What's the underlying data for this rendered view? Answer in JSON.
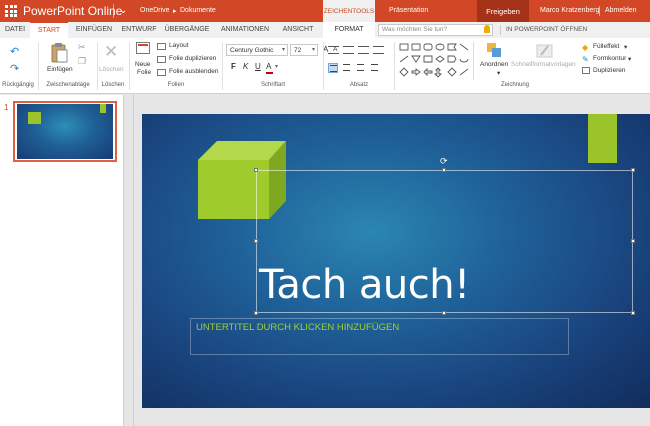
{
  "titlebar": {
    "app_title": "PowerPoint Online",
    "breadcrumb": [
      "OneDrive",
      "Dokumente"
    ],
    "breadcrumb_arrow": "▸",
    "contextual_header": "ZEICHENTOOLS",
    "document_title": "Präsentation",
    "share_label": "Freigeben",
    "user_name": "Marco Kratzenberg",
    "logout_label": "Abmelden",
    "accent_color": "#d24726"
  },
  "tabs": [
    "DATEI",
    "START",
    "EINFÜGEN",
    "ENTWURF",
    "ÜBERGÄNGE",
    "ANIMATIONEN",
    "ANSICHT",
    "FORMAT"
  ],
  "active_tab": "START",
  "search": {
    "placeholder": "Was möchten Sie tun?"
  },
  "open_in_desktop": "IN POWERPOINT ÖFFNEN",
  "ribbon": {
    "groups": {
      "undo": "Rückgängig",
      "clipboard": "Zwischenablage",
      "delete": "Löschen",
      "slides": "Folien",
      "font": "Schriftart",
      "paragraph": "Absatz",
      "drawing": "Zeichnung"
    },
    "paste_label": "Einfügen",
    "delete_label": "Löschen",
    "new_slide_label_1": "Neue",
    "new_slide_label_2": "Folie",
    "layout_label": "Layout",
    "duplicate_slide_label": "Folie duplizieren",
    "hide_slide_label": "Folie ausblenden",
    "font_name": "Century Gothic",
    "font_size": "72",
    "bold_label": "F",
    "italic_label": "K",
    "underline_label": "U",
    "fontcolor_label": "A",
    "arrange_label": "Anordnen",
    "quickstyles_label": "Schnellformatvorlagen",
    "fill_label": "Fülleffekt",
    "outline_label": "Formkontur",
    "duplicate_label": "Duplizieren"
  },
  "thumbnails": [
    {
      "number": "1"
    }
  ],
  "slide": {
    "title": "Tach auch!",
    "subtitle_placeholder": "UNTERTITEL DURCH KLICKEN HINZUFÜGEN",
    "accent_green": "#9ac42a",
    "background": "#1f6199"
  }
}
